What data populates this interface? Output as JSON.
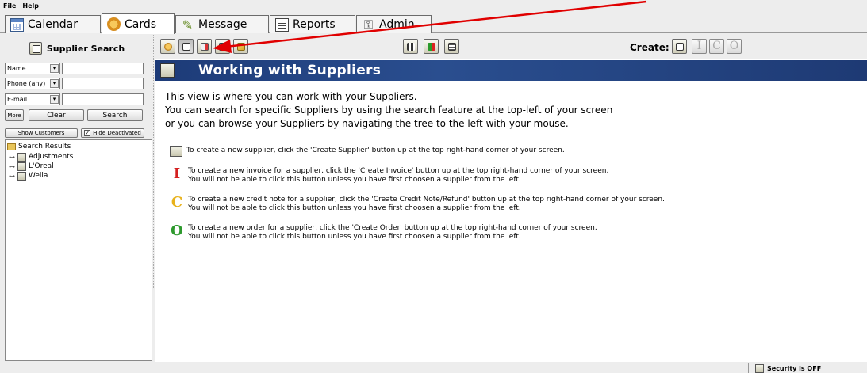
{
  "menu": {
    "file": "File",
    "help": "Help"
  },
  "tabs": [
    {
      "label": "Calendar",
      "icon": "calendar-icon"
    },
    {
      "label": "Cards",
      "icon": "cards-icon"
    },
    {
      "label": "Message",
      "icon": "message-icon"
    },
    {
      "label": "Reports",
      "icon": "reports-icon"
    },
    {
      "label": "Admin",
      "icon": "admin-icon"
    }
  ],
  "sidebar": {
    "title": "Supplier Search",
    "fields": [
      {
        "select": "Name",
        "value": ""
      },
      {
        "select": "Phone (any)",
        "value": ""
      },
      {
        "select": "E-mail",
        "value": ""
      }
    ],
    "more_label": "More",
    "clear_label": "Clear",
    "search_label": "Search",
    "show_customers_label": "Show Customers",
    "hide_deactivated_label": "Hide Deactivated",
    "hide_deactivated_checked": true,
    "tree": {
      "root": "Search Results",
      "items": [
        "Adjustments",
        "L'Oreal",
        "Wella"
      ]
    }
  },
  "toolbar": {
    "create_label": "Create:",
    "create_buttons": [
      "I",
      "C",
      "O"
    ]
  },
  "main": {
    "banner_title": "Working with Suppliers",
    "intro": [
      "This view is where you can work with your Suppliers.",
      "You can search for specific Suppliers by using the search feature at the top-left of your screen",
      "or you can browse your Suppliers by navigating the tree to the left with your mouse."
    ],
    "info": [
      {
        "icon": "S",
        "line1": "To create a new supplier, click the 'Create Supplier' button up at the top right-hand corner of your screen.",
        "line2": ""
      },
      {
        "icon": "I",
        "line1": "To create a new invoice for a supplier, click the 'Create Invoice' button up at the top right-hand corner of your screen.",
        "line2": "You will not be able to click this button unless you have first choosen a supplier from the left."
      },
      {
        "icon": "C",
        "line1": "To create a new credit note for a supplier, click the 'Create Credit Note/Refund' button up at the top right-hand corner of your screen.",
        "line2": "You will not be able to click this button unless you have first choosen a supplier from the left."
      },
      {
        "icon": "O",
        "line1": "To create a new order for a supplier, click the 'Create Order' button up at the top right-hand corner of your screen.",
        "line2": "You will not be able to click this button unless you have first choosen a supplier from the left."
      }
    ]
  },
  "status": {
    "security": "Security is OFF"
  },
  "colors": {
    "banner": "#1d3b78",
    "invoice_icon": "#d42020",
    "credit_icon": "#e8b21c",
    "order_icon": "#2e9a2e",
    "annotation_arrow": "#e00000"
  }
}
